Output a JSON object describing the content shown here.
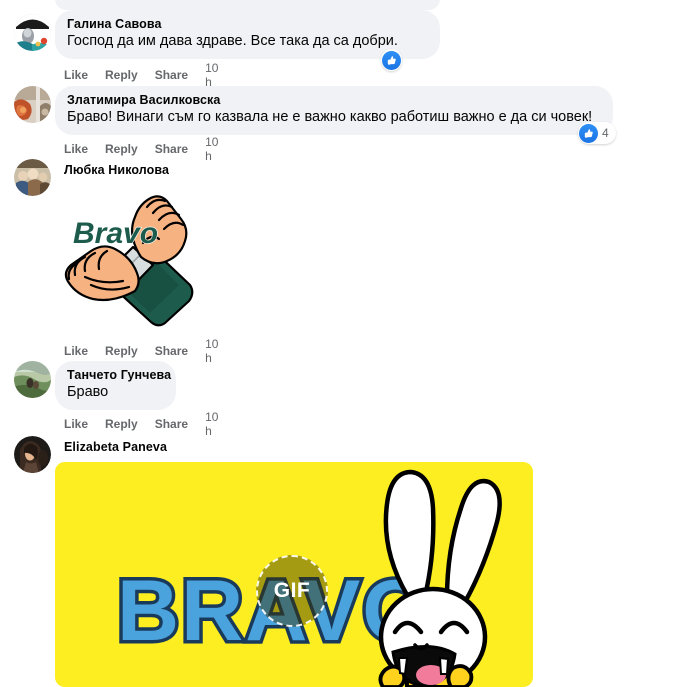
{
  "app": {
    "name": "facebook-comments-thread",
    "background": "#ffffff",
    "bubble_color": "#f0f2f5"
  },
  "top_partial_row": {
    "glyph": "· · ·"
  },
  "action_labels": {
    "like": "Like",
    "reply": "Reply",
    "share": "Share"
  },
  "colors": {
    "accent_blue": "#1b74e4",
    "text_primary": "#050505",
    "text_secondary": "#65676b",
    "bubble": "#f0f2f5",
    "gif_yellow": "#fcee21",
    "bravo_blue": "#4aa3dc",
    "bravo_outline": "#1a3a5c",
    "sticker_green": "#1d5c4d",
    "skin": "#f7b282"
  },
  "comments": [
    {
      "id": "comment-1",
      "author": "Галина Савова",
      "text": "Господ да им дава здраве. Все така да са добри.",
      "timestamp": "10 h",
      "reaction": {
        "type": "like",
        "count": ""
      }
    },
    {
      "id": "comment-2",
      "author": "Златимира Василковска",
      "text": "Браво! Винаги съм го казвала не е важно какво работиш важно е да си човек!",
      "timestamp": "10 h",
      "reaction": {
        "type": "like",
        "count": "4"
      }
    },
    {
      "id": "comment-3",
      "author": "Любка Николова",
      "text": "",
      "timestamp": "10 h",
      "attachment": {
        "kind": "sticker",
        "label": "Bravo",
        "description": "clapping-hands-bravo-sticker"
      }
    },
    {
      "id": "comment-4",
      "author": "Танчето Гунчева",
      "text": "Браво",
      "timestamp": "10 h"
    },
    {
      "id": "comment-5",
      "author": "Elizabeta Paneva",
      "text": "",
      "attachment": {
        "kind": "gif",
        "label": "BRAVO !",
        "badge": "GIF",
        "description": "yellow-bravo-bunny-gif"
      }
    }
  ]
}
